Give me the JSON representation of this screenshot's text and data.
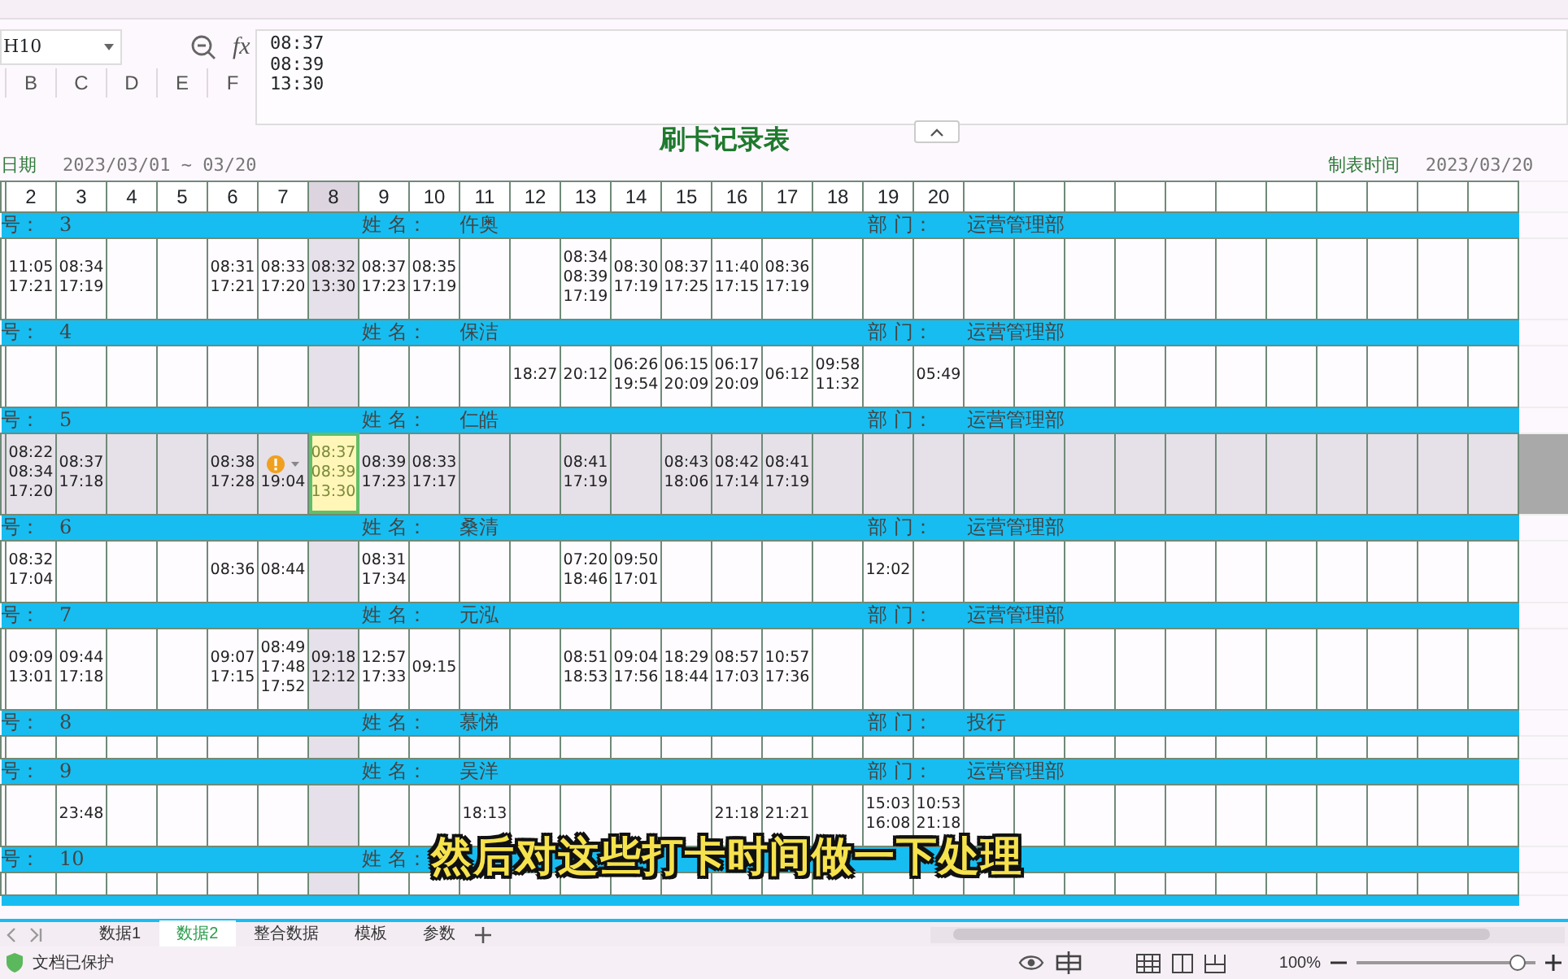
{
  "formula_bar": {
    "cell_ref": "H10",
    "fx_label": "fx",
    "content": [
      "08:37",
      "08:39",
      "13:30"
    ]
  },
  "column_letters": [
    "B",
    "C",
    "D",
    "E",
    "F"
  ],
  "sheet": {
    "title": "刷卡记录表",
    "date_label": "日期",
    "date_range": "2023/03/01 ~ 03/20",
    "made_label": "制表时间",
    "made_date": "2023/03/20",
    "days": [
      {
        "label": "2",
        "selected": false
      },
      {
        "label": "3",
        "selected": false
      },
      {
        "label": "4",
        "selected": false
      },
      {
        "label": "5",
        "selected": false
      },
      {
        "label": "6",
        "selected": false
      },
      {
        "label": "7",
        "selected": false
      },
      {
        "label": "8",
        "selected": true
      },
      {
        "label": "9",
        "selected": false
      },
      {
        "label": "10",
        "selected": false
      },
      {
        "label": "11",
        "selected": false
      },
      {
        "label": "12",
        "selected": false
      },
      {
        "label": "13",
        "selected": false
      },
      {
        "label": "14",
        "selected": false
      },
      {
        "label": "15",
        "selected": false
      },
      {
        "label": "16",
        "selected": false
      },
      {
        "label": "17",
        "selected": false
      },
      {
        "label": "18",
        "selected": false
      },
      {
        "label": "19",
        "selected": false
      },
      {
        "label": "20",
        "selected": false
      }
    ],
    "employees": [
      {
        "id_label": "号：",
        "id": "3",
        "name_label": "姓 名：",
        "name": "仵奥",
        "dept_label": "部 门：",
        "dept": "运营管理部",
        "selected": false,
        "cells": [
          [
            "11:05",
            "17:21"
          ],
          [
            "08:34",
            "17:19"
          ],
          [],
          [],
          [
            "08:31",
            "17:21"
          ],
          [
            "08:33",
            "17:20"
          ],
          [
            "08:32",
            "13:30"
          ],
          [
            "08:37",
            "17:23"
          ],
          [
            "08:35",
            "17:19"
          ],
          [],
          [],
          [
            "08:34",
            "08:39",
            "17:19"
          ],
          [
            "08:30",
            "17:19"
          ],
          [
            "08:37",
            "17:25"
          ],
          [
            "11:40",
            "17:15"
          ],
          [
            "08:36",
            "17:19"
          ],
          [],
          [],
          []
        ]
      },
      {
        "id_label": "号：",
        "id": "4",
        "name_label": "姓 名：",
        "name": "保洁",
        "dept_label": "部 门：",
        "dept": "运营管理部",
        "selected": false,
        "cells": [
          [],
          [],
          [],
          [],
          [],
          [],
          [],
          [],
          [],
          [],
          [
            "18:27"
          ],
          [
            "20:12"
          ],
          [
            "06:26",
            "19:54"
          ],
          [
            "06:15",
            "20:09"
          ],
          [
            "06:17",
            "20:09"
          ],
          [
            "06:12"
          ],
          [
            "09:58",
            "11:32"
          ],
          [],
          [
            "05:49"
          ]
        ]
      },
      {
        "id_label": "号：",
        "id": "5",
        "name_label": "姓 名：",
        "name": "仁皓",
        "dept_label": "部 门：",
        "dept": "运营管理部",
        "selected": true,
        "cells": [
          [
            "08:22",
            "08:34",
            "17:20"
          ],
          [
            "08:37",
            "17:18"
          ],
          [],
          [],
          [
            "08:38",
            "17:28"
          ],
          {
            "times": [
              "19:04"
            ],
            "warning": true,
            "selected": false
          },
          {
            "times": [
              "08:37",
              "08:39",
              "13:30"
            ],
            "warning": false,
            "selected": true
          },
          [
            "08:39",
            "17:23"
          ],
          [
            "08:33",
            "17:17"
          ],
          [],
          [],
          [
            "08:41",
            "17:19"
          ],
          [],
          [
            "08:43",
            "18:06"
          ],
          [
            "08:42",
            "17:14"
          ],
          [
            "08:41",
            "17:19"
          ],
          [],
          [],
          []
        ]
      },
      {
        "id_label": "号：",
        "id": "6",
        "name_label": "姓 名：",
        "name": "桑清",
        "dept_label": "部 门：",
        "dept": "运营管理部",
        "selected": false,
        "cells": [
          [
            "08:32",
            "17:04"
          ],
          [],
          [],
          [],
          [
            "08:36"
          ],
          [
            "08:44"
          ],
          [],
          [
            "08:31",
            "17:34"
          ],
          [],
          [],
          [],
          [
            "07:20",
            "18:46"
          ],
          [
            "09:50",
            "17:01"
          ],
          [],
          [],
          [],
          [],
          [
            "12:02"
          ],
          []
        ]
      },
      {
        "id_label": "号：",
        "id": "7",
        "name_label": "姓 名：",
        "name": "元泓",
        "dept_label": "部 门：",
        "dept": "运营管理部",
        "selected": false,
        "cells": [
          [
            "09:09",
            "13:01"
          ],
          [
            "09:44",
            "17:18"
          ],
          [],
          [],
          [
            "09:07",
            "17:15"
          ],
          [
            "08:49",
            "17:48",
            "17:52"
          ],
          [
            "09:18",
            "12:12"
          ],
          [
            "12:57",
            "17:33"
          ],
          [
            "09:15"
          ],
          [],
          [],
          [
            "08:51",
            "18:53"
          ],
          [
            "09:04",
            "17:56"
          ],
          [
            "18:29",
            "18:44"
          ],
          [
            "08:57",
            "17:03"
          ],
          [
            "10:57",
            "17:36"
          ],
          [],
          [],
          []
        ]
      },
      {
        "id_label": "号：",
        "id": "8",
        "name_label": "姓 名：",
        "name": "慕悌",
        "dept_label": "部 门：",
        "dept": "投行",
        "selected": false
      },
      {
        "id_label": "号：",
        "id": "9",
        "name_label": "姓 名：",
        "name": "吴洋",
        "dept_label": "部 门：",
        "dept": "运营管理部",
        "selected": false,
        "cells": [
          [],
          [
            "23:48"
          ],
          [],
          [],
          [],
          [],
          [],
          [],
          [],
          [
            "18:13"
          ],
          [],
          [],
          [],
          [],
          [
            "21:18"
          ],
          [
            "21:21"
          ],
          [],
          [
            "15:03",
            "16:08"
          ],
          [
            "10:53",
            "21:18"
          ]
        ]
      },
      {
        "id_label": "号：",
        "id": "10",
        "name_label": "姓 名：",
        "selected": false
      }
    ]
  },
  "caption": "然后对这些打卡时间做一下处理",
  "sheet_tabs": [
    {
      "label": "数据1",
      "selected": false
    },
    {
      "label": "数据2",
      "selected": true
    },
    {
      "label": "整合数据",
      "selected": false
    },
    {
      "label": "模板",
      "selected": false
    },
    {
      "label": "参数",
      "selected": false
    }
  ],
  "status_bar": {
    "protection": "文档已保护",
    "zoom": "100%",
    "zoom_slider": {
      "level": 0.9
    }
  }
}
